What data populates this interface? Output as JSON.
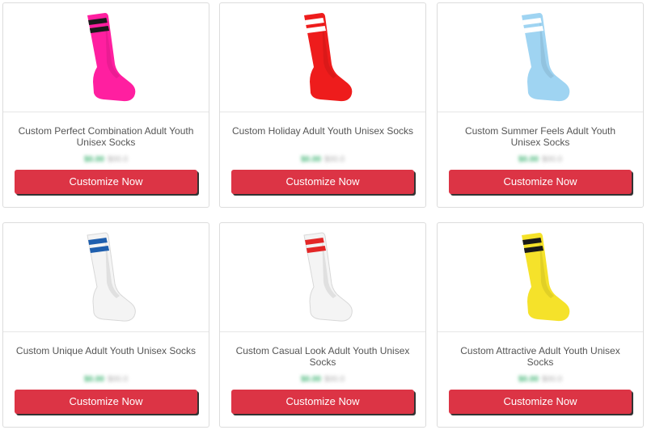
{
  "products": [
    {
      "title": "Custom Perfect Combination Adult Youth Unisex Socks",
      "sale_price": "$0.00",
      "regular_price": "$00.0",
      "button_label": "Customize Now",
      "sock_color": "#ff1fa0",
      "stripe_color": "#1a1a1a",
      "image_name": "pink-sock-icon"
    },
    {
      "title": "Custom Holiday Adult Youth Unisex Socks",
      "sale_price": "$0.00",
      "regular_price": "$00.0",
      "button_label": "Customize Now",
      "sock_color": "#ee1c1c",
      "stripe_color": "#ffffff",
      "image_name": "red-sock-icon"
    },
    {
      "title": "Custom Summer Feels Adult Youth Unisex Socks",
      "sale_price": "$0.00",
      "regular_price": "$00.0",
      "button_label": "Customize Now",
      "sock_color": "#9fd4f2",
      "stripe_color": "#ffffff",
      "image_name": "light-blue-sock-icon"
    },
    {
      "title": "Custom Unique Adult Youth Unisex Socks",
      "sale_price": "$0.00",
      "regular_price": "$00.0",
      "button_label": "Customize Now",
      "sock_color": "#f4f4f4",
      "stripe_color": "#1f5fae",
      "image_name": "white-blue-stripe-sock-icon"
    },
    {
      "title": "Custom Casual Look Adult Youth Unisex Socks",
      "sale_price": "$0.00",
      "regular_price": "$00.0",
      "button_label": "Customize Now",
      "sock_color": "#f4f4f4",
      "stripe_color": "#e32727",
      "image_name": "white-red-stripe-sock-icon"
    },
    {
      "title": "Custom Attractive Adult Youth Unisex Socks",
      "sale_price": "$0.00",
      "regular_price": "$00.0",
      "button_label": "Customize Now",
      "sock_color": "#f5e22a",
      "stripe_color": "#1a1a1a",
      "image_name": "yellow-sock-icon"
    }
  ]
}
